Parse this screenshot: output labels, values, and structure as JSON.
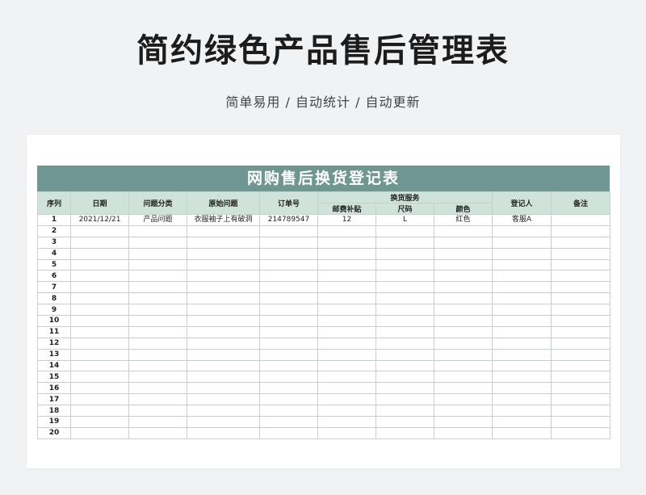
{
  "page": {
    "title": "简约绿色产品售后管理表",
    "subtitle": "简单易用 / 自动统计 / 自动更新"
  },
  "sheet": {
    "banner": "网购售后换货登记表",
    "headers": {
      "index": "序列",
      "date": "日期",
      "category": "问题分类",
      "issue": "原始问题",
      "order_no": "订单号",
      "exchange_group": "换货服务",
      "postage": "邮费补贴",
      "size": "尺码",
      "color": "颜色",
      "registrar": "登记人",
      "note": "备注"
    },
    "rows": [
      {
        "index": "1",
        "date": "2021/12/21",
        "category": "产品问题",
        "issue": "衣服袖子上有破洞",
        "order_no": "214789547",
        "postage": "12",
        "size": "L",
        "color": "红色",
        "registrar": "客服A",
        "note": ""
      },
      {
        "index": "2",
        "date": "",
        "category": "",
        "issue": "",
        "order_no": "",
        "postage": "",
        "size": "",
        "color": "",
        "registrar": "",
        "note": ""
      },
      {
        "index": "3",
        "date": "",
        "category": "",
        "issue": "",
        "order_no": "",
        "postage": "",
        "size": "",
        "color": "",
        "registrar": "",
        "note": ""
      },
      {
        "index": "4",
        "date": "",
        "category": "",
        "issue": "",
        "order_no": "",
        "postage": "",
        "size": "",
        "color": "",
        "registrar": "",
        "note": ""
      },
      {
        "index": "5",
        "date": "",
        "category": "",
        "issue": "",
        "order_no": "",
        "postage": "",
        "size": "",
        "color": "",
        "registrar": "",
        "note": ""
      },
      {
        "index": "6",
        "date": "",
        "category": "",
        "issue": "",
        "order_no": "",
        "postage": "",
        "size": "",
        "color": "",
        "registrar": "",
        "note": ""
      },
      {
        "index": "7",
        "date": "",
        "category": "",
        "issue": "",
        "order_no": "",
        "postage": "",
        "size": "",
        "color": "",
        "registrar": "",
        "note": ""
      },
      {
        "index": "8",
        "date": "",
        "category": "",
        "issue": "",
        "order_no": "",
        "postage": "",
        "size": "",
        "color": "",
        "registrar": "",
        "note": ""
      },
      {
        "index": "9",
        "date": "",
        "category": "",
        "issue": "",
        "order_no": "",
        "postage": "",
        "size": "",
        "color": "",
        "registrar": "",
        "note": ""
      },
      {
        "index": "10",
        "date": "",
        "category": "",
        "issue": "",
        "order_no": "",
        "postage": "",
        "size": "",
        "color": "",
        "registrar": "",
        "note": ""
      },
      {
        "index": "11",
        "date": "",
        "category": "",
        "issue": "",
        "order_no": "",
        "postage": "",
        "size": "",
        "color": "",
        "registrar": "",
        "note": ""
      },
      {
        "index": "12",
        "date": "",
        "category": "",
        "issue": "",
        "order_no": "",
        "postage": "",
        "size": "",
        "color": "",
        "registrar": "",
        "note": ""
      },
      {
        "index": "13",
        "date": "",
        "category": "",
        "issue": "",
        "order_no": "",
        "postage": "",
        "size": "",
        "color": "",
        "registrar": "",
        "note": ""
      },
      {
        "index": "14",
        "date": "",
        "category": "",
        "issue": "",
        "order_no": "",
        "postage": "",
        "size": "",
        "color": "",
        "registrar": "",
        "note": ""
      },
      {
        "index": "15",
        "date": "",
        "category": "",
        "issue": "",
        "order_no": "",
        "postage": "",
        "size": "",
        "color": "",
        "registrar": "",
        "note": ""
      },
      {
        "index": "16",
        "date": "",
        "category": "",
        "issue": "",
        "order_no": "",
        "postage": "",
        "size": "",
        "color": "",
        "registrar": "",
        "note": ""
      },
      {
        "index": "17",
        "date": "",
        "category": "",
        "issue": "",
        "order_no": "",
        "postage": "",
        "size": "",
        "color": "",
        "registrar": "",
        "note": ""
      },
      {
        "index": "18",
        "date": "",
        "category": "",
        "issue": "",
        "order_no": "",
        "postage": "",
        "size": "",
        "color": "",
        "registrar": "",
        "note": ""
      },
      {
        "index": "19",
        "date": "",
        "category": "",
        "issue": "",
        "order_no": "",
        "postage": "",
        "size": "",
        "color": "",
        "registrar": "",
        "note": ""
      },
      {
        "index": "20",
        "date": "",
        "category": "",
        "issue": "",
        "order_no": "",
        "postage": "",
        "size": "",
        "color": "",
        "registrar": "",
        "note": ""
      }
    ]
  },
  "colors": {
    "banner": "#6f9690",
    "header": "#cfe3da",
    "background": "#f1f2f4"
  }
}
